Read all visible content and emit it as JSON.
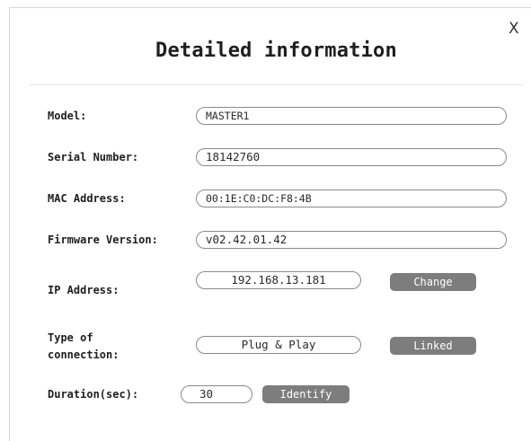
{
  "dialog": {
    "title": "Detailed information",
    "close_label": "X"
  },
  "fields": {
    "model": {
      "label": "Model:",
      "value": "MASTER1"
    },
    "serial_number": {
      "label": "Serial Number:",
      "value": "18142760"
    },
    "mac_address": {
      "label": "MAC Address:",
      "value": "00:1E:C0:DC:F8:4B"
    },
    "firmware_version": {
      "label": "Firmware Version:",
      "value": "v02.42.01.42"
    },
    "ip_address": {
      "label": "IP Address:",
      "value": "192.168.13.181",
      "button": "Change"
    },
    "connection_type": {
      "label_line1": "Type of",
      "label_line2": "connection:",
      "value": "Plug & Play",
      "button": "Linked"
    },
    "duration": {
      "label": "Duration(sec):",
      "value": "30",
      "button": "Identify"
    }
  },
  "colors": {
    "button_bg": "#7d7d7d",
    "field_border": "#8a8a8a",
    "text": "#1e1e1e"
  }
}
